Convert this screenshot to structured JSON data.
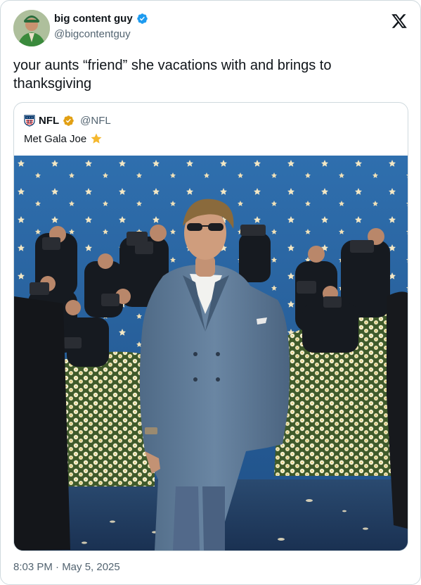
{
  "author": {
    "display_name": "big content guy",
    "handle": "@bigcontentguy",
    "verified_color": "#1d9bf0"
  },
  "tweet": {
    "text": "your aunts “friend” she vacations with and brings to thanksgiving",
    "timestamp": "8:03 PM · May 5, 2025"
  },
  "quoted_tweet": {
    "display_name": "NFL",
    "handle": "@NFL",
    "verified_color": "#e2a014",
    "text": "Met Gala Joe",
    "emoji_icon": "star-icon"
  },
  "icons": {
    "close": "x-logo-icon"
  },
  "colors": {
    "text_primary": "#0f1419",
    "text_secondary": "#536471",
    "border": "#cfd9de",
    "backdrop_blue": "#2f6aa6",
    "suit_blue": "#5e7893"
  }
}
